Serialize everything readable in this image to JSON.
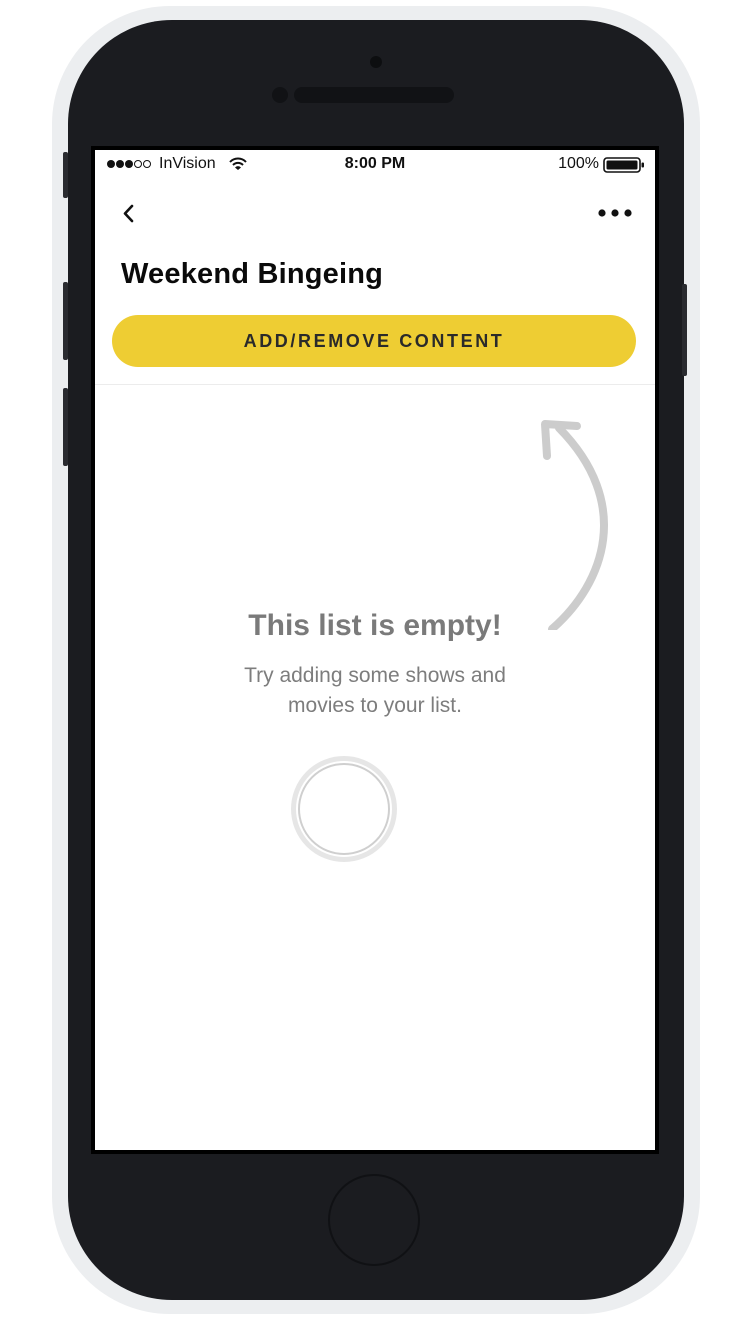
{
  "status_bar": {
    "signal_bars": [
      true,
      true,
      true,
      false,
      false
    ],
    "carrier": "InVision",
    "wifi_icon": "wifi-icon",
    "time": "8:00 PM",
    "battery_percent": "100%",
    "battery_icon": "battery-full-icon"
  },
  "nav": {
    "back_icon": "chevron-left-icon",
    "more_icon": "more-horizontal-icon"
  },
  "header": {
    "title": "Weekend Bingeing"
  },
  "actions": {
    "primary_label": "ADD/REMOVE CONTENT"
  },
  "empty_state": {
    "title": "This list is empty!",
    "message": "Try adding some shows and movies to your list.",
    "hint_icon": "curved-arrow-up-icon"
  },
  "colors": {
    "accent": "#eecd33",
    "title_text": "#0a0a0a",
    "muted_text": "#7a7a7a",
    "device_frame": "#1b1c20"
  }
}
